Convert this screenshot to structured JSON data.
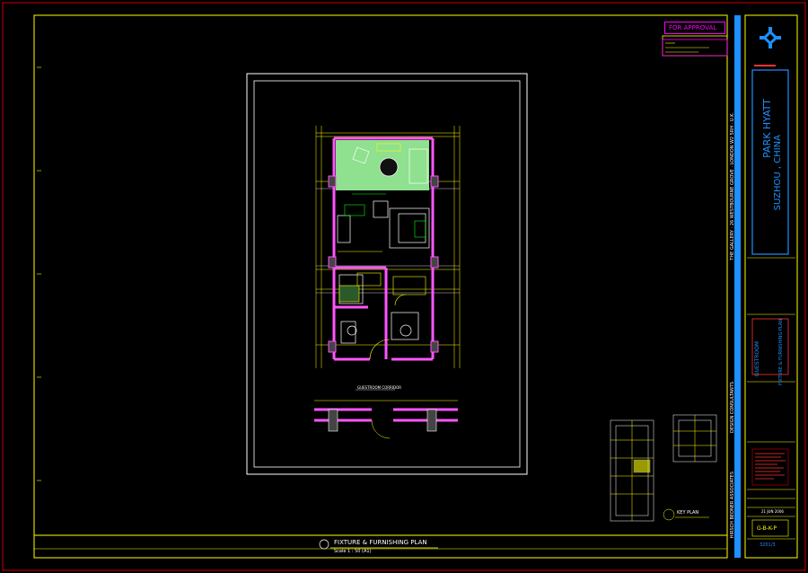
{
  "colors": {
    "background": "#000000",
    "frame_red": "#cc0000",
    "frame_yellow": "#ffff00",
    "accent_blue": "#1e90ff",
    "wall_magenta": "#ff55ff",
    "floor_green": "#8fe08f",
    "line_white": "#ffffff",
    "text_cyan": "#00ffff"
  },
  "stamp": {
    "label": "FOR APPROVAL"
  },
  "project": {
    "name": "PARK HYATT",
    "location": "SUZHOU , CHINA"
  },
  "consultant": {
    "address": "THE GALLERY · 26 WESTBOURNE GROVE · LONDON W2 5RH · U.K.",
    "name": "HIRSCH BEDNER ASSOCIATES",
    "role": "DESIGN CONSULTANTS"
  },
  "drawing": {
    "room": "GUESTROOM",
    "subtitle": "FIXTURE & FURNISHING PLAN",
    "plan_title": "FIXTURE & FURNISHING PLAN",
    "scale": "Scale 1 : 50 (A1)",
    "corridor_label": "GUESTROOM CORRIDOR",
    "date": "21 JUN 2006",
    "drawing_no": "G-B-K-P",
    "job_no": "3201/3"
  },
  "key_plan": {
    "label": "KEY PLAN"
  }
}
